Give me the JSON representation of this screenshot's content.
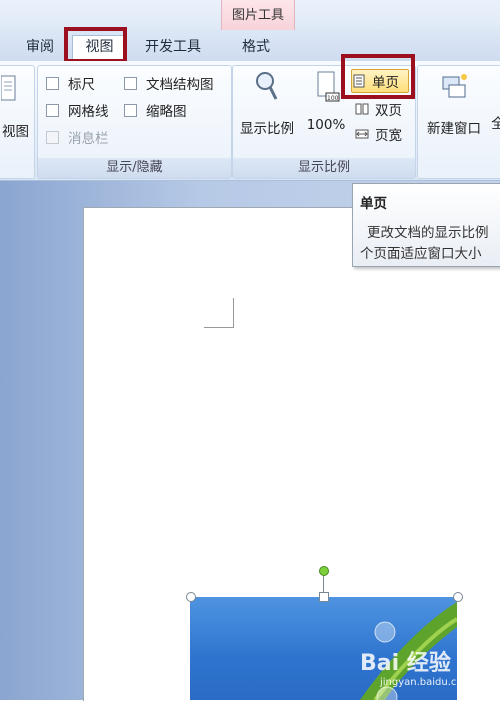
{
  "context_tab": {
    "label": "图片工具"
  },
  "tabs": [
    {
      "label": "审阅"
    },
    {
      "label": "视图"
    },
    {
      "label": "开发工具"
    },
    {
      "label": "格式"
    }
  ],
  "ribbon": {
    "views_group": {
      "button_label": "视图"
    },
    "show_hide_group": {
      "label": "显示/隐藏",
      "ruler": "标尺",
      "gridlines": "网格线",
      "message_bar": "消息栏",
      "document_map": "文档结构图",
      "thumbnails": "缩略图"
    },
    "zoom_group": {
      "label": "显示比例",
      "zoom": "显示比例",
      "zoom_100": "100%",
      "one_page": "单页",
      "two_pages": "双页",
      "page_width": "页宽"
    },
    "window_group": {
      "new_window": "新建窗口",
      "next_label": "全"
    }
  },
  "tooltip": {
    "title": "单页",
    "line1": "更改文档的显示比例",
    "line2": "个页面适应窗口大小"
  },
  "watermark": {
    "text": "Bai 经验",
    "sub": "jingyan.baidu.com"
  },
  "colors": {
    "highlight": "#9b0f1f",
    "hover": "#ffdf7b"
  }
}
